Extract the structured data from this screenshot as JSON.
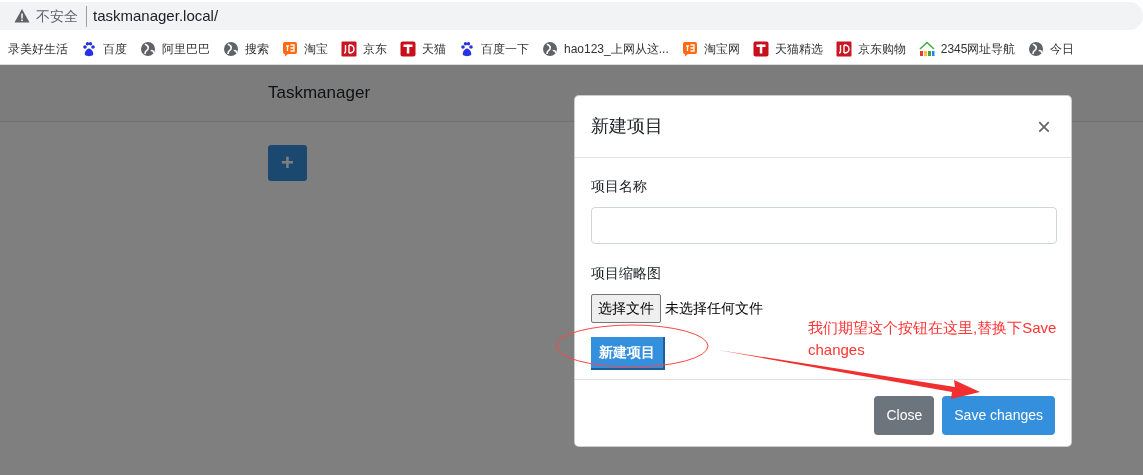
{
  "browser": {
    "security_label": "不安全",
    "url": "taskmanager.local/"
  },
  "bookmarks": [
    {
      "label": "录美好生活",
      "kind": "none"
    },
    {
      "label": "百度",
      "kind": "paw"
    },
    {
      "label": "阿里巴巴",
      "kind": "globe"
    },
    {
      "label": "搜索",
      "kind": "globe"
    },
    {
      "label": "淘宝",
      "kind": "bubble"
    },
    {
      "label": "京东",
      "kind": "tile"
    },
    {
      "label": "天猫",
      "kind": "square"
    },
    {
      "label": "百度一下",
      "kind": "paw"
    },
    {
      "label": "hao123_上网从这...",
      "kind": "globe"
    },
    {
      "label": "淘宝网",
      "kind": "bubble"
    },
    {
      "label": "天猫精选",
      "kind": "square"
    },
    {
      "label": "京东购物",
      "kind": "tile"
    },
    {
      "label": "2345网址导航",
      "kind": "house"
    },
    {
      "label": "今日",
      "kind": "globe"
    }
  ],
  "navbar": {
    "brand": "Taskmanager"
  },
  "add_button": {
    "label": "+"
  },
  "modal": {
    "title": "新建项目",
    "close_symbol": "×",
    "fields": [
      {
        "kind": "text",
        "label": "项目名称"
      },
      {
        "kind": "file",
        "label": "项目缩略图",
        "button": "选择文件",
        "status": "未选择任何文件"
      }
    ],
    "submit_button": "新建项目",
    "footer_buttons": [
      {
        "label": "Close",
        "kind": "secondary"
      },
      {
        "label": "Save changes",
        "kind": "primary"
      }
    ]
  },
  "annotation": {
    "note": "我们期望这个按钮在这里,替换下Save changes"
  }
}
